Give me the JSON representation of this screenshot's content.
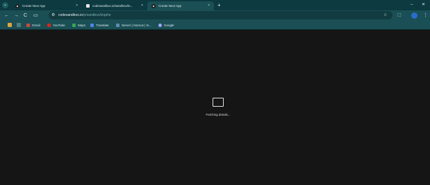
{
  "tabs": [
    {
      "title": "Create Next App",
      "favicon": "nextjs-favicon",
      "active": false
    },
    {
      "title": "codesandbox.io/sandbox/lo...",
      "favicon": "codesandbox-favicon",
      "active": false
    },
    {
      "title": "Create Next App",
      "favicon": "nextjs-favicon",
      "active": true
    }
  ],
  "tab_close_glyph": "×",
  "new_tab_glyph": "+",
  "window_controls": {
    "minimize": "–",
    "close": "✕"
  },
  "toolbar": {
    "back": "←",
    "forward": "→",
    "reload": "C",
    "url_host": "codesandbox.io",
    "url_path": "/p/sandbox/lzqahe",
    "star": "☆",
    "extensions": "⬚",
    "menu": "⋮"
  },
  "bookmarks": [
    {
      "label": "Gmail",
      "color": "#d44638"
    },
    {
      "label": "YouTube",
      "color": "#e62117"
    },
    {
      "label": "Maps",
      "color": "#34a853"
    },
    {
      "label": "Translate",
      "color": "#4a86e8"
    },
    {
      "label": "Server | Atomos | N...",
      "color": "#5b8fb0"
    },
    {
      "label": "Google",
      "color": "#9aa7ff"
    }
  ],
  "content": {
    "loading_text": "Fetching details..."
  },
  "colors": {
    "tabstrip": "#0c3a40",
    "toolbar": "#1a4f55",
    "content_bg": "#151515"
  }
}
